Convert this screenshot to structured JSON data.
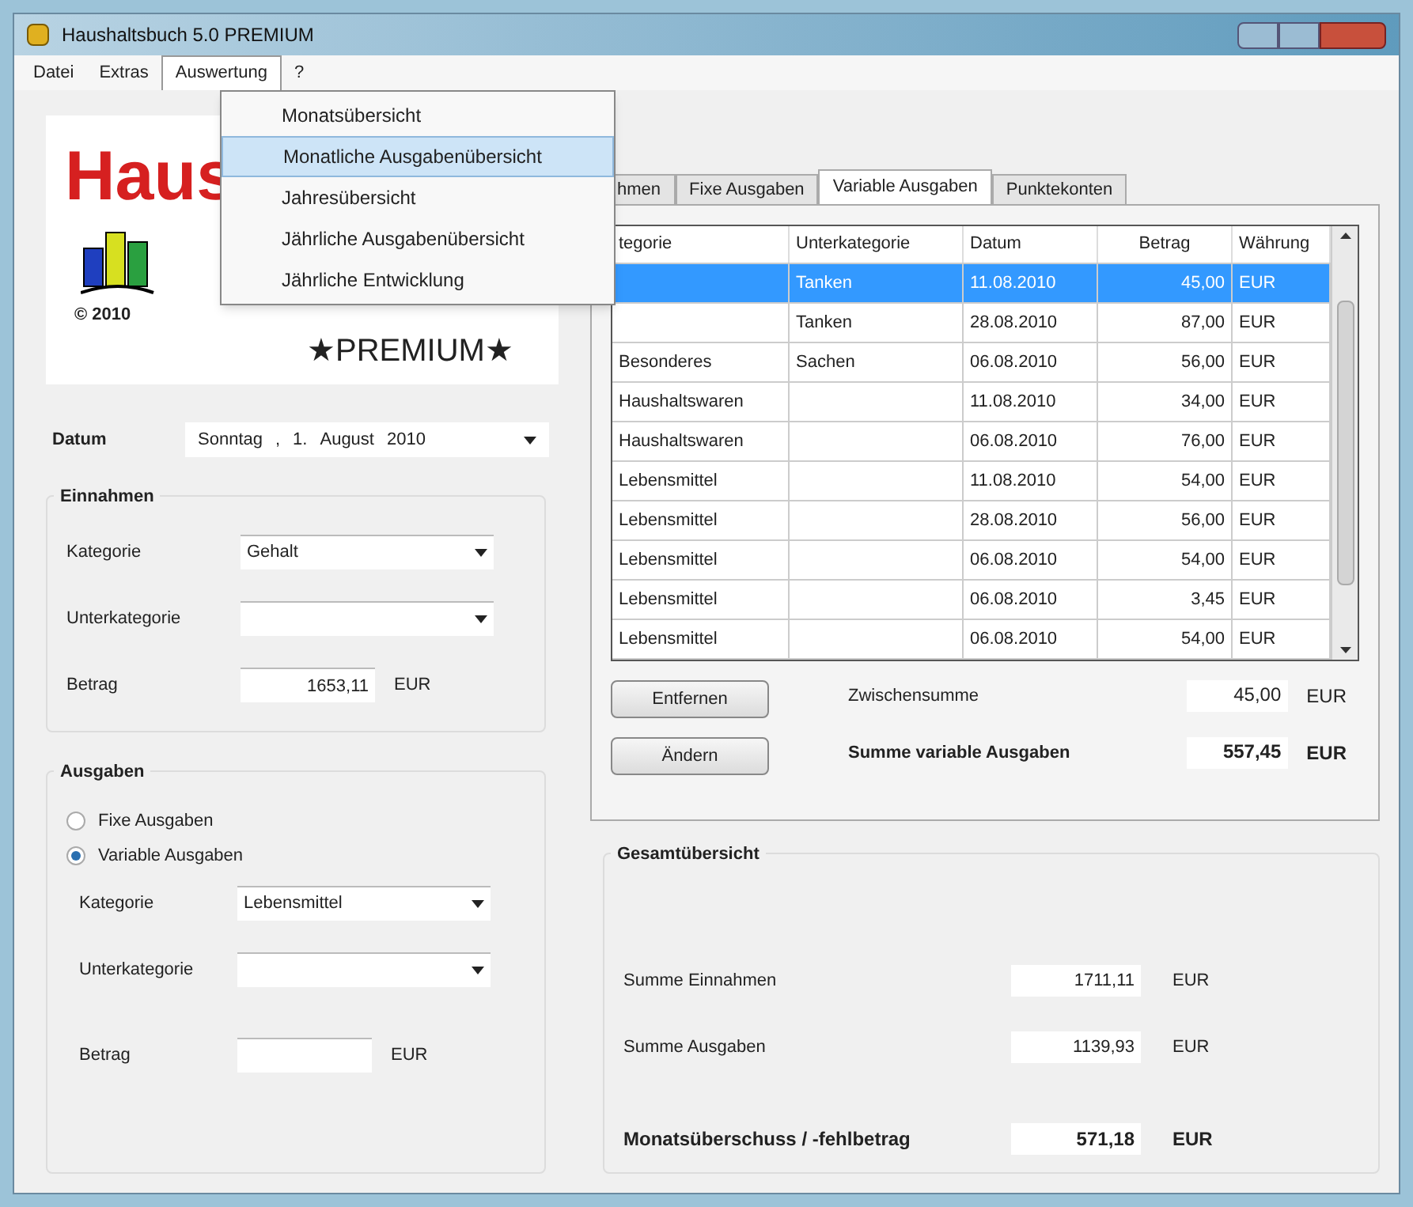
{
  "window": {
    "title": "Haushaltsbuch 5.0 PREMIUM"
  },
  "menu_bar": [
    {
      "label": "Datei",
      "selected": false
    },
    {
      "label": "Extras",
      "selected": false
    },
    {
      "label": "Auswertung",
      "selected": true
    },
    {
      "label": "?",
      "selected": false
    }
  ],
  "dropdown_menu": [
    {
      "label": "Monatsübersicht",
      "selected": false
    },
    {
      "label": "Monatliche Ausgabenübersicht",
      "selected": true
    },
    {
      "label": "Jahresübersicht",
      "selected": false
    },
    {
      "label": "Jährliche Ausgabenübersicht",
      "selected": false
    },
    {
      "label": "Jährliche Entwicklung",
      "selected": false
    }
  ],
  "logo": {
    "title": "Haus",
    "copyright": "© 2010",
    "edition": "★PREMIUM★"
  },
  "date": {
    "label": "Datum",
    "weekday": "Sonntag",
    "sep": ",",
    "day": "1.",
    "month": "August",
    "year": "2010"
  },
  "income": {
    "title": "Einnahmen",
    "category_label": "Kategorie",
    "category": "Gehalt",
    "subcategory_label": "Unterkategorie",
    "amount_label": "Betrag",
    "amount": "1653,11",
    "currency": "EUR"
  },
  "expenses": {
    "title": "Ausgaben",
    "options": [
      {
        "label": "Fixe Ausgaben",
        "selected": false
      },
      {
        "label": "Variable Ausgaben",
        "selected": true
      }
    ],
    "category_label": "Kategorie",
    "category": "Lebensmittel",
    "subcategory_label": "Unterkategorie",
    "amount_label": "Betrag",
    "currency": "EUR"
  },
  "tabs": [
    {
      "label": "hmen",
      "selected": false
    },
    {
      "label": "Fixe Ausgaben",
      "selected": false
    },
    {
      "label": "Variable Ausgaben",
      "selected": true
    },
    {
      "label": "Punktekonten",
      "selected": false
    }
  ],
  "table": {
    "columns": [
      "tegorie",
      "Unterkategorie",
      "Datum",
      "Betrag",
      "Währung"
    ],
    "rows": [
      {
        "subcategory": "Tanken",
        "date": "11.08.2010",
        "amount": "45,00",
        "currency": "EUR",
        "selected": true
      },
      {
        "subcategory": "Tanken",
        "date": "28.08.2010",
        "amount": "87,00",
        "currency": "EUR",
        "selected": false
      },
      {
        "category": "Besonderes",
        "subcategory": "Sachen",
        "date": "06.08.2010",
        "amount": "56,00",
        "currency": "EUR",
        "selected": false
      },
      {
        "category": "Haushaltswaren",
        "date": "11.08.2010",
        "amount": "34,00",
        "currency": "EUR",
        "selected": false
      },
      {
        "category": "Haushaltswaren",
        "date": "06.08.2010",
        "amount": "76,00",
        "currency": "EUR",
        "selected": false
      },
      {
        "category": "Lebensmittel",
        "date": "11.08.2010",
        "amount": "54,00",
        "currency": "EUR",
        "selected": false
      },
      {
        "category": "Lebensmittel",
        "date": "28.08.2010",
        "amount": "56,00",
        "currency": "EUR",
        "selected": false
      },
      {
        "category": "Lebensmittel",
        "date": "06.08.2010",
        "amount": "54,00",
        "currency": "EUR",
        "selected": false
      },
      {
        "category": "Lebensmittel",
        "date": "06.08.2010",
        "amount": "3,45",
        "currency": "EUR",
        "selected": false
      },
      {
        "category": "Lebensmittel",
        "date": "06.08.2010",
        "amount": "54,00",
        "currency": "EUR",
        "selected": false
      }
    ]
  },
  "buttons": [
    "Entfernen",
    "Ändern"
  ],
  "subtotal": {
    "label": "Zwischensumme",
    "value": "45,00",
    "currency": "EUR"
  },
  "total": {
    "label": "Summe variable Ausgaben",
    "value": "557,45",
    "currency": "EUR"
  },
  "overview": {
    "title": "Gesamtübersicht",
    "rows": [
      {
        "label": "Summe Einnahmen",
        "value": "1711,11",
        "currency": "EUR",
        "kind": "normal"
      },
      {
        "label": "Summe Ausgaben",
        "value": "1139,93",
        "currency": "EUR",
        "kind": "normal"
      },
      {
        "label": "Monatsüberschuss / -fehlbetrag",
        "value": "571,18",
        "currency": "EUR",
        "kind": "bold"
      }
    ]
  }
}
